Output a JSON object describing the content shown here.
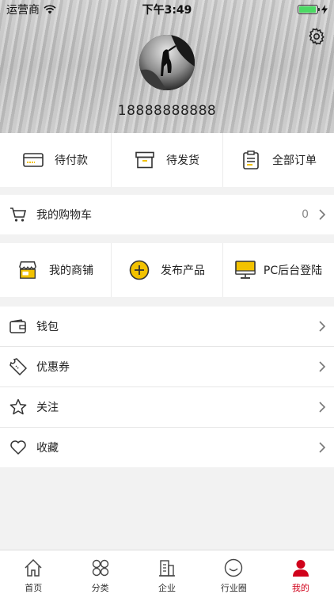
{
  "status_bar": {
    "carrier": "运营商",
    "time": "下午3:49",
    "battery_level": 0.95
  },
  "profile": {
    "phone": "18888888888"
  },
  "orders": [
    {
      "label": "待付款",
      "icon": "card-icon"
    },
    {
      "label": "待发货",
      "icon": "box-icon"
    },
    {
      "label": "全部订单",
      "icon": "clipboard-icon"
    }
  ],
  "cart": {
    "label": "我的购物车",
    "count": "0"
  },
  "shop": [
    {
      "label": "我的商铺",
      "icon": "shop-icon"
    },
    {
      "label": "发布产品",
      "icon": "plus-circle-icon"
    },
    {
      "label": "PC后台登陆",
      "icon": "monitor-icon"
    }
  ],
  "menu": [
    {
      "label": "钱包",
      "icon": "wallet-icon"
    },
    {
      "label": "优惠券",
      "icon": "coupon-icon"
    },
    {
      "label": "关注",
      "icon": "star-icon"
    },
    {
      "label": "收藏",
      "icon": "heart-icon"
    }
  ],
  "tabs": [
    {
      "label": "首页",
      "icon": "home-icon"
    },
    {
      "label": "分类",
      "icon": "category-icon"
    },
    {
      "label": "企业",
      "icon": "building-icon"
    },
    {
      "label": "行业圈",
      "icon": "smile-icon"
    },
    {
      "label": "我的",
      "icon": "person-icon",
      "active": true
    }
  ],
  "colors": {
    "accent": "#f2c200",
    "active_tab": "#d0021b",
    "battery": "#4cd964"
  }
}
